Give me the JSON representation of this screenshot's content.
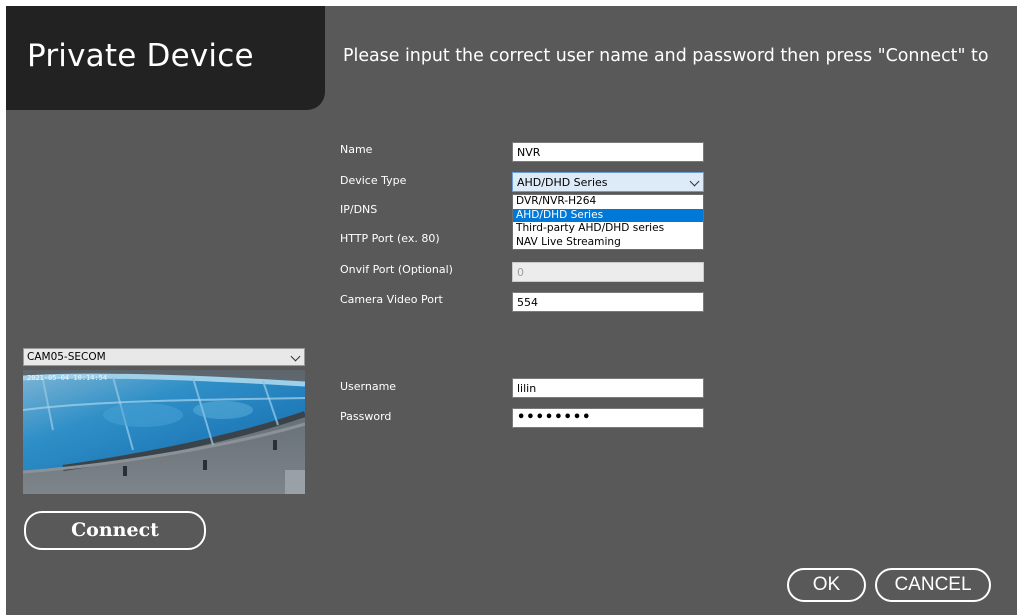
{
  "window": {
    "title": "Private Device",
    "instruction": "Please input the correct user name and password then press \"Connect\" to"
  },
  "form": {
    "name_label": "Name",
    "name_value": "NVR",
    "device_type_label": "Device Type",
    "device_type_value": "AHD/DHD Series",
    "device_type_options": [
      "DVR/NVR-H264",
      "AHD/DHD Series",
      "Third-party AHD/DHD series",
      "NAV Live Streaming"
    ],
    "ip_label": "IP/DNS",
    "http_port_label": "HTTP Port (ex. 80)",
    "onvif_port_label": "Onvif Port (Optional)",
    "onvif_port_value": "0",
    "camera_port_label": "Camera Video Port",
    "camera_port_value": "554",
    "username_label": "Username",
    "username_value": "lilin",
    "password_label": "Password",
    "password_value": "••••••••"
  },
  "preview": {
    "camera_select": "CAM05-SECOM",
    "overlay_text": "2021-05-04 10:14:54"
  },
  "buttons": {
    "connect": "Connect",
    "ok": "OK",
    "cancel": "CANCEL"
  },
  "colors": {
    "background": "#595959",
    "title_bar": "#222222",
    "selection": "#0078d7"
  }
}
